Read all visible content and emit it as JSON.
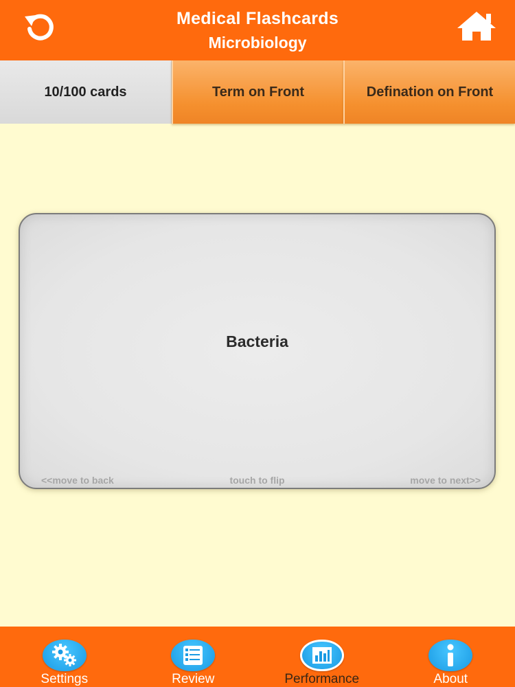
{
  "header": {
    "title": "Medical Flashcards",
    "subtitle": "Microbiology",
    "back_icon": "refresh-back-icon",
    "home_icon": "home-icon"
  },
  "segments": [
    {
      "label": "10/100 cards",
      "state": "active"
    },
    {
      "label": "Term on Front",
      "state": "orange"
    },
    {
      "label": "Defination on Front",
      "state": "orange"
    }
  ],
  "card": {
    "term": "Bacteria",
    "hint_back": "<<move to back",
    "hint_flip": "touch to flip",
    "hint_next": "move to next>>"
  },
  "tabs": [
    {
      "label": "Settings",
      "icon": "gears-icon"
    },
    {
      "label": "Review",
      "icon": "list-icon"
    },
    {
      "label": "Performance",
      "icon": "bar-chart-icon",
      "selected": true
    },
    {
      "label": "About",
      "icon": "info-icon"
    }
  ],
  "colors": {
    "accent": "#ff6a0d",
    "background": "#fffbd0",
    "segment_orange": "#f5902e",
    "tab_icon_blue": "#1a9ae3"
  }
}
